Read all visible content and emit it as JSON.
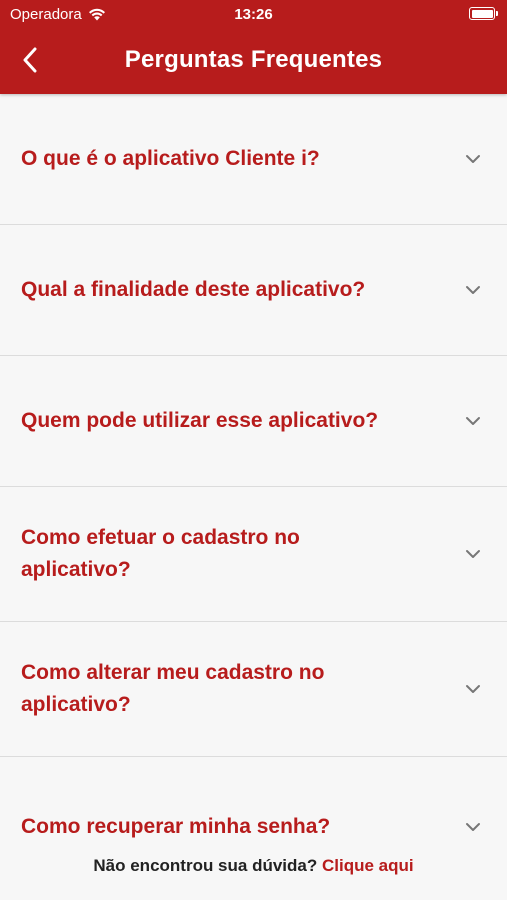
{
  "status_bar": {
    "carrier": "Operadora",
    "time": "13:26"
  },
  "header": {
    "title": "Perguntas Frequentes",
    "back_icon": "chevron-left-icon"
  },
  "faq": {
    "items": [
      {
        "question": "O que é o aplicativo Cliente i?"
      },
      {
        "question": "Qual a finalidade deste aplicativo?"
      },
      {
        "question": "Quem pode utilizar esse aplicativo?"
      },
      {
        "question": "Como efetuar o cadastro no aplicativo?"
      },
      {
        "question": "Como alterar meu cadastro no aplicativo?"
      },
      {
        "question": "Como recuperar minha senha?"
      }
    ],
    "expand_icon": "chevron-down-icon"
  },
  "footer": {
    "text": "Não encontrou sua dúvida?",
    "link": "Clique aqui"
  },
  "colors": {
    "brand": "#b71c1c",
    "background": "#f7f7f7",
    "divider": "#dcdcdc"
  }
}
